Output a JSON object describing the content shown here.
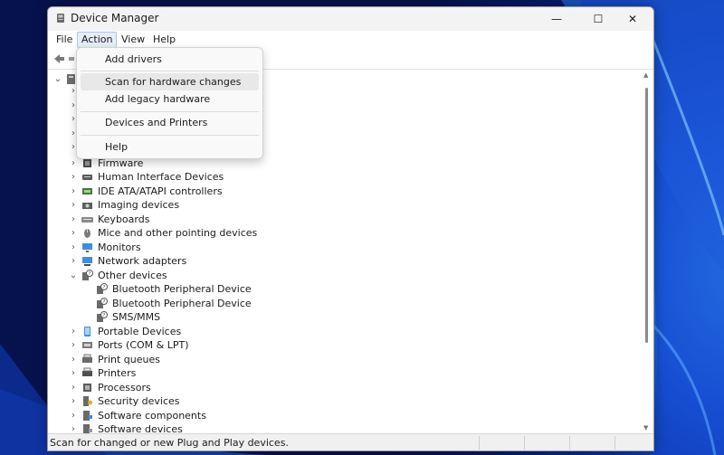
{
  "window": {
    "title": "Device Manager",
    "controls": {
      "minimize": "—",
      "maximize": "☐",
      "close": "✕"
    }
  },
  "menubar": {
    "items": [
      {
        "label": "File"
      },
      {
        "label": "Action"
      },
      {
        "label": "View"
      },
      {
        "label": "Help"
      }
    ]
  },
  "action_menu": {
    "items": [
      {
        "label": "Add drivers"
      },
      {
        "label": "Scan for hardware changes"
      },
      {
        "label": "Add legacy hardware"
      },
      {
        "label": "Devices and Printers"
      },
      {
        "label": "Help"
      }
    ]
  },
  "tree": {
    "expander_collapsed": "›",
    "expander_expanded": "⌄",
    "categories": [
      {
        "label": "Firmware",
        "icon": "firmware-icon"
      },
      {
        "label": "Human Interface Devices",
        "icon": "hid-icon"
      },
      {
        "label": "IDE ATA/ATAPI controllers",
        "icon": "ide-controller-icon"
      },
      {
        "label": "Imaging devices",
        "icon": "camera-icon"
      },
      {
        "label": "Keyboards",
        "icon": "keyboard-icon"
      },
      {
        "label": "Mice and other pointing devices",
        "icon": "mouse-icon"
      },
      {
        "label": "Monitors",
        "icon": "monitor-icon"
      },
      {
        "label": "Network adapters",
        "icon": "network-adapter-icon"
      },
      {
        "label": "Other devices",
        "icon": "unknown-device-icon",
        "expanded": true
      },
      {
        "label": "Portable Devices",
        "icon": "portable-device-icon"
      },
      {
        "label": "Ports (COM & LPT)",
        "icon": "port-icon"
      },
      {
        "label": "Print queues",
        "icon": "print-queue-icon"
      },
      {
        "label": "Printers",
        "icon": "printer-icon"
      },
      {
        "label": "Processors",
        "icon": "processor-icon"
      },
      {
        "label": "Security devices",
        "icon": "security-device-icon"
      },
      {
        "label": "Software components",
        "icon": "software-component-icon"
      },
      {
        "label": "Software devices",
        "icon": "software-device-icon"
      }
    ],
    "other_devices_children": [
      {
        "label": "Bluetooth Peripheral Device",
        "icon": "unknown-device-icon"
      },
      {
        "label": "Bluetooth Peripheral Device",
        "icon": "unknown-device-icon"
      },
      {
        "label": "SMS/MMS",
        "icon": "unknown-device-icon"
      }
    ]
  },
  "statusbar": {
    "text": "Scan for changed or new Plug and Play devices."
  },
  "colors": {
    "menu_active_bg": "#e5eef9",
    "menu_hover_bg": "#e8e8e8",
    "desktop_accent": "#1d5fe6"
  }
}
